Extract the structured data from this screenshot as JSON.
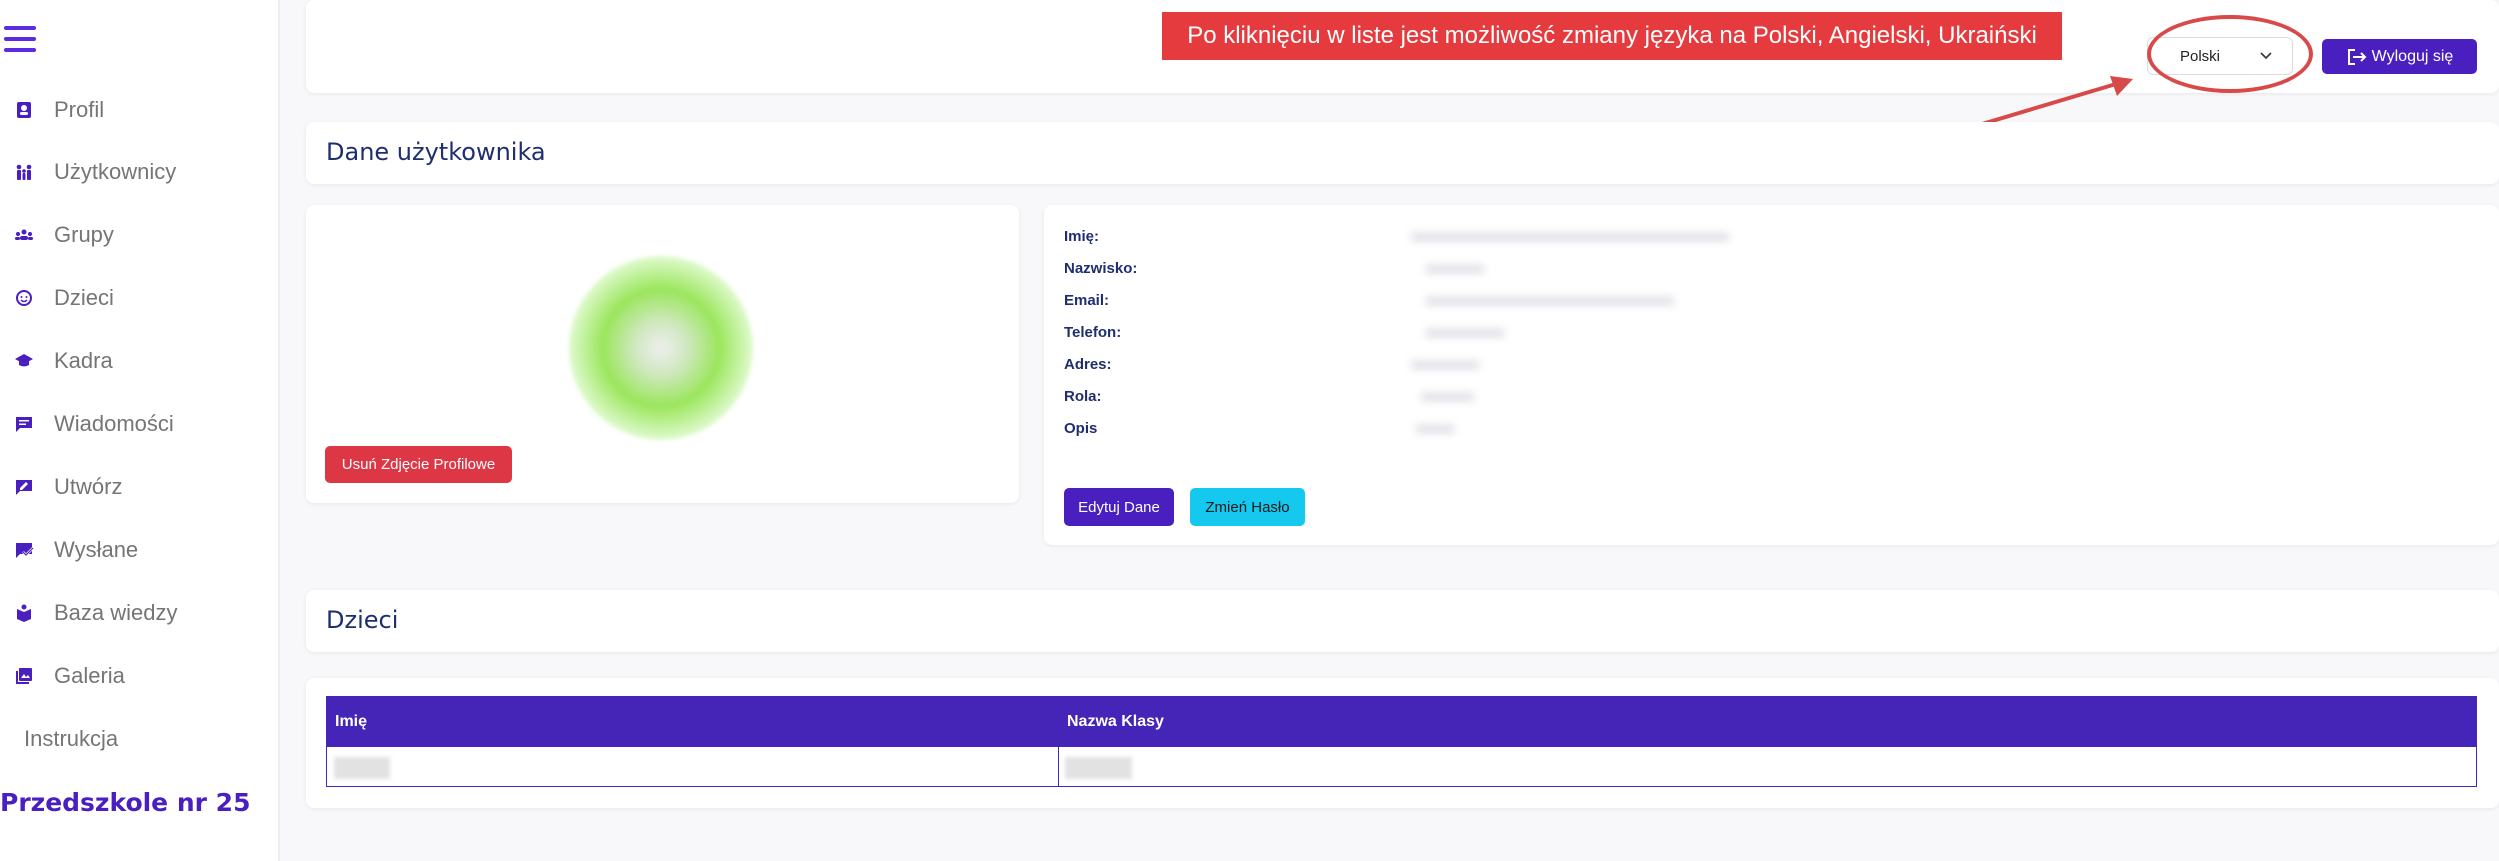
{
  "sidebar": {
    "items": [
      {
        "label": "Profil",
        "icon": "person-badge-icon"
      },
      {
        "label": "Użytkownicy",
        "icon": "users-icon"
      },
      {
        "label": "Grupy",
        "icon": "groups-icon"
      },
      {
        "label": "Dzieci",
        "icon": "child-face-icon"
      },
      {
        "label": "Kadra",
        "icon": "graduation-cap-icon"
      },
      {
        "label": "Wiadomości",
        "icon": "message-icon"
      },
      {
        "label": "Utwórz",
        "icon": "compose-icon"
      },
      {
        "label": "Wysłane",
        "icon": "sent-icon"
      },
      {
        "label": "Baza wiedzy",
        "icon": "book-icon"
      },
      {
        "label": "Galeria",
        "icon": "gallery-icon"
      }
    ],
    "instruction": "Instrukcja",
    "brand": "Przedszkole nr 25"
  },
  "header": {
    "language_selected": "Polski",
    "logout_label": "Wyloguj się"
  },
  "annotation": {
    "text": "Po kliknięciu w liste jest możliwość zmiany języka na Polski, Angielski, Ukraiński"
  },
  "user_section": {
    "title": "Dane użytkownika",
    "remove_photo_label": "Usuń Zdjęcie Profilowe",
    "fields": [
      "Imię:",
      "Nazwisko:",
      "Email:",
      "Telefon:",
      "Adres:",
      "Rola:",
      "Opis"
    ],
    "edit_label": "Edytuj Dane",
    "change_password_label": "Zmień Hasło"
  },
  "children_section": {
    "title": "Dzieci",
    "columns": [
      "Imię",
      "Nazwa Klasy"
    ]
  },
  "colors": {
    "accent": "#4a1fc0",
    "danger": "#dd3645",
    "info": "#14c8ee",
    "annotation": "#e53b3f"
  }
}
